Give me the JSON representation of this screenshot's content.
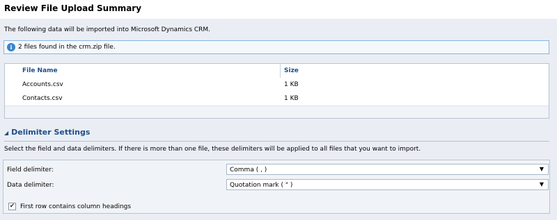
{
  "page": {
    "title": "Review File Upload Summary"
  },
  "intro": {
    "text": "The following data will be imported into Microsoft Dynamics CRM."
  },
  "info_bar": {
    "icon": "info-icon",
    "text": "2 files found in the crm.zip file."
  },
  "file_table": {
    "columns": [
      "File Name",
      "Size"
    ],
    "rows": [
      {
        "name": "Accounts.csv",
        "size": "1 KB"
      },
      {
        "name": "Contacts.csv",
        "size": "1 KB"
      }
    ]
  },
  "delimiter_settings": {
    "heading": "Delimiter Settings",
    "description": "Select the field and data delimiters. If there is more than one file, these delimiters will be applied to all files that you want to import.",
    "field_delimiter": {
      "label": "Field delimiter:",
      "value": "Comma ( , )"
    },
    "data_delimiter": {
      "label": "Data delimiter:",
      "value": "Quotation mark ( \" )"
    },
    "first_row_headings": {
      "label": "First row contains column headings",
      "checked": true
    }
  },
  "colors": {
    "accent": "#1f4e8a",
    "info_border": "#8ab4e0",
    "background": "#eaeef4"
  }
}
